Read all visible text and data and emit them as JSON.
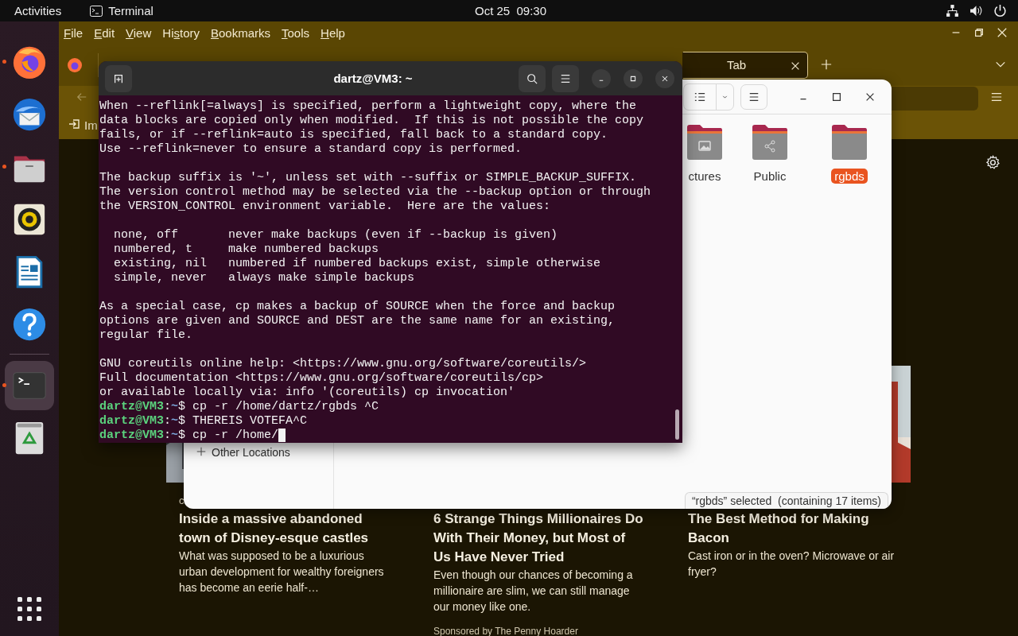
{
  "top_bar": {
    "activities": "Activities",
    "app": "Terminal",
    "clock": "Oct 25  09:30"
  },
  "dock": {
    "items": [
      {
        "kind": "firefox",
        "running": true,
        "selected": false
      },
      {
        "kind": "thunderbird",
        "running": false,
        "selected": false
      },
      {
        "kind": "files",
        "running": true,
        "selected": false
      },
      {
        "kind": "rhythmbox",
        "running": false,
        "selected": false
      },
      {
        "kind": "writer",
        "running": false,
        "selected": false
      },
      {
        "kind": "help",
        "running": false,
        "selected": false
      },
      {
        "kind": "terminal",
        "running": true,
        "selected": true
      },
      {
        "kind": "trash",
        "running": false,
        "selected": false
      }
    ]
  },
  "browser": {
    "menu": [
      {
        "key": "F",
        "post": "ile"
      },
      {
        "key": "E",
        "post": "dit"
      },
      {
        "key": "V",
        "post": "iew"
      },
      {
        "pre": "Hi",
        "key": "s",
        "post": "tory"
      },
      {
        "key": "B",
        "post": "ookmarks"
      },
      {
        "key": "T",
        "post": "ools"
      },
      {
        "key": "H",
        "post": "elp"
      }
    ],
    "tabs": [
      {
        "label": "Tab",
        "selected": true
      }
    ],
    "bookmarks": [
      {
        "label": "Im"
      }
    ],
    "cards": [
      {
        "category": "c",
        "title": "Inside a massive abandoned town of Disney-esque castles",
        "description": "What was supposed to be a luxurious urban development for wealthy foreigners has become an eerie half-…"
      },
      {
        "title": "6 Strange Things Millionaires Do With Their Money, but Most of Us Have Never Tried",
        "description": "Even though our chances of becoming a millionaire are slim, we can still manage our money like one.",
        "sponsor": "Sponsored by The Penny Hoarder"
      },
      {
        "title": "The Best Method for Making Bacon",
        "description": "Cast iron or in the oven? Microwave or air fryer?"
      }
    ]
  },
  "file_manager": {
    "sidebar": [
      {
        "label": "Other Locations"
      }
    ],
    "folders": [
      {
        "label": "ctures",
        "kind": "pictures",
        "selected": false
      },
      {
        "label": "Public",
        "kind": "public",
        "selected": false
      },
      {
        "label": "rgbds",
        "kind": "plain",
        "selected": true
      }
    ],
    "status": "“rgbds” selected  (containing 17 items)"
  },
  "terminal": {
    "title": "dartz@VM3: ~",
    "lines": [
      {
        "kind": "text",
        "text": "When --reflink[=always] is specified, perform a lightweight copy, where the"
      },
      {
        "kind": "text",
        "text": "data blocks are copied only when modified.  If this is not possible the copy"
      },
      {
        "kind": "text",
        "text": "fails, or if --reflink=auto is specified, fall back to a standard copy."
      },
      {
        "kind": "text",
        "text": "Use --reflink=never to ensure a standard copy is performed."
      },
      {
        "kind": "blank"
      },
      {
        "kind": "text",
        "text": "The backup suffix is '~', unless set with --suffix or SIMPLE_BACKUP_SUFFIX."
      },
      {
        "kind": "text",
        "text": "The version control method may be selected via the --backup option or through"
      },
      {
        "kind": "text",
        "text": "the VERSION_CONTROL environment variable.  Here are the values:"
      },
      {
        "kind": "blank"
      },
      {
        "kind": "text",
        "text": "  none, off       never make backups (even if --backup is given)"
      },
      {
        "kind": "text",
        "text": "  numbered, t     make numbered backups"
      },
      {
        "kind": "text",
        "text": "  existing, nil   numbered if numbered backups exist, simple otherwise"
      },
      {
        "kind": "text",
        "text": "  simple, never   always make simple backups"
      },
      {
        "kind": "blank"
      },
      {
        "kind": "text",
        "text": "As a special case, cp makes a backup of SOURCE when the force and backup"
      },
      {
        "kind": "text",
        "text": "options are given and SOURCE and DEST are the same name for an existing,"
      },
      {
        "kind": "text",
        "text": "regular file."
      },
      {
        "kind": "blank"
      },
      {
        "kind": "text",
        "text": "GNU coreutils online help: <https://www.gnu.org/software/coreutils/>"
      },
      {
        "kind": "text",
        "text": "Full documentation <https://www.gnu.org/software/coreutils/cp>"
      },
      {
        "kind": "text",
        "text": "or available locally via: info '(coreutils) cp invocation'"
      },
      {
        "kind": "prompt",
        "host": "dartz@VM3",
        "sep": ":",
        "path": "~",
        "sigil": "$",
        "command": "cp -r /home/dartz/rgbds ^C",
        "cursor": false
      },
      {
        "kind": "prompt",
        "host": "dartz@VM3",
        "sep": ":",
        "path": "~",
        "sigil": "$",
        "command": "THEREIS VOTEFA^C",
        "cursor": false
      },
      {
        "kind": "prompt",
        "host": "dartz@VM3",
        "sep": ":",
        "path": "~",
        "sigil": "$",
        "command": "cp -r /home/",
        "cursor": true
      }
    ]
  }
}
